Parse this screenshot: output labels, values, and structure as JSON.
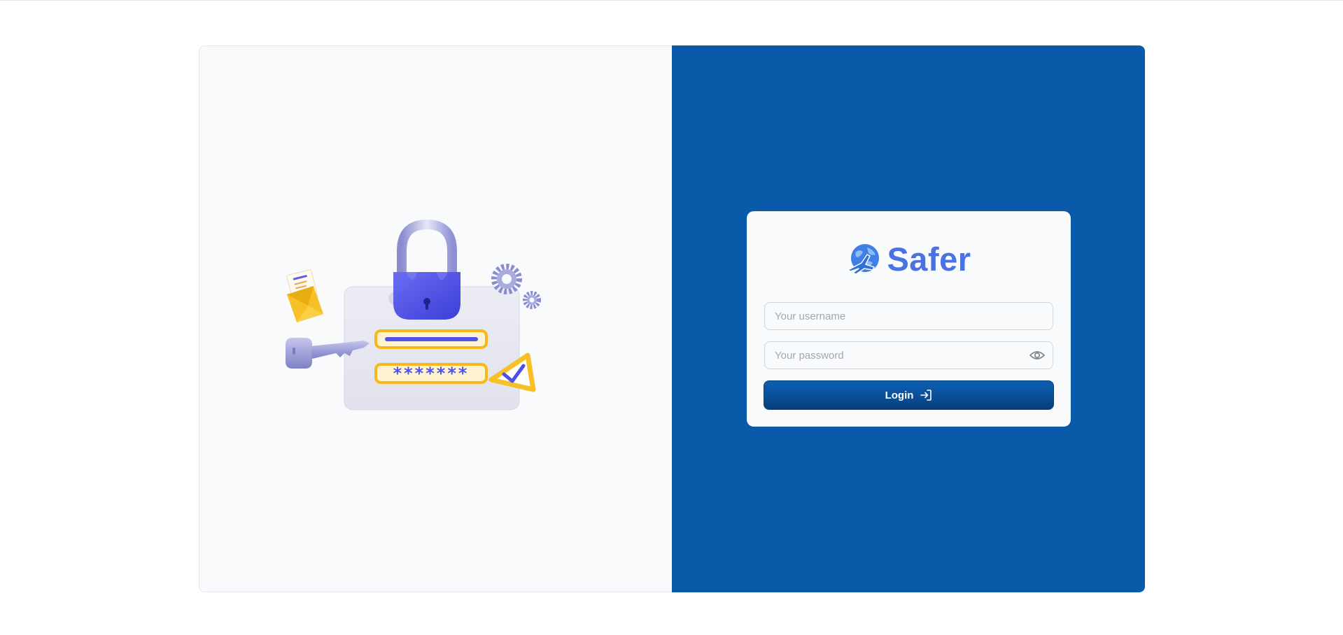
{
  "brand": {
    "name": "Safer",
    "logo_icon": "globe-airplane-icon",
    "logo_color": "#3f7fe6"
  },
  "form": {
    "username": {
      "placeholder": "Your username",
      "value": ""
    },
    "password": {
      "placeholder": "Your password",
      "value": "",
      "toggle_icon": "eye-icon"
    },
    "login_label": "Login",
    "login_icon": "log-in-icon"
  },
  "illustration": {
    "subject": "security-login-illustration",
    "masked_password": "*******"
  },
  "colors": {
    "panel_blue": "#0a5aaa",
    "left_panel": "#f9fafb",
    "card": "#f8fafc",
    "brand_text": "#4a72e0",
    "button_top": "#0c5fb4",
    "button_bottom": "#073e78",
    "accent_purple": "#5b5ce8",
    "accent_yellow": "#f6c026"
  }
}
